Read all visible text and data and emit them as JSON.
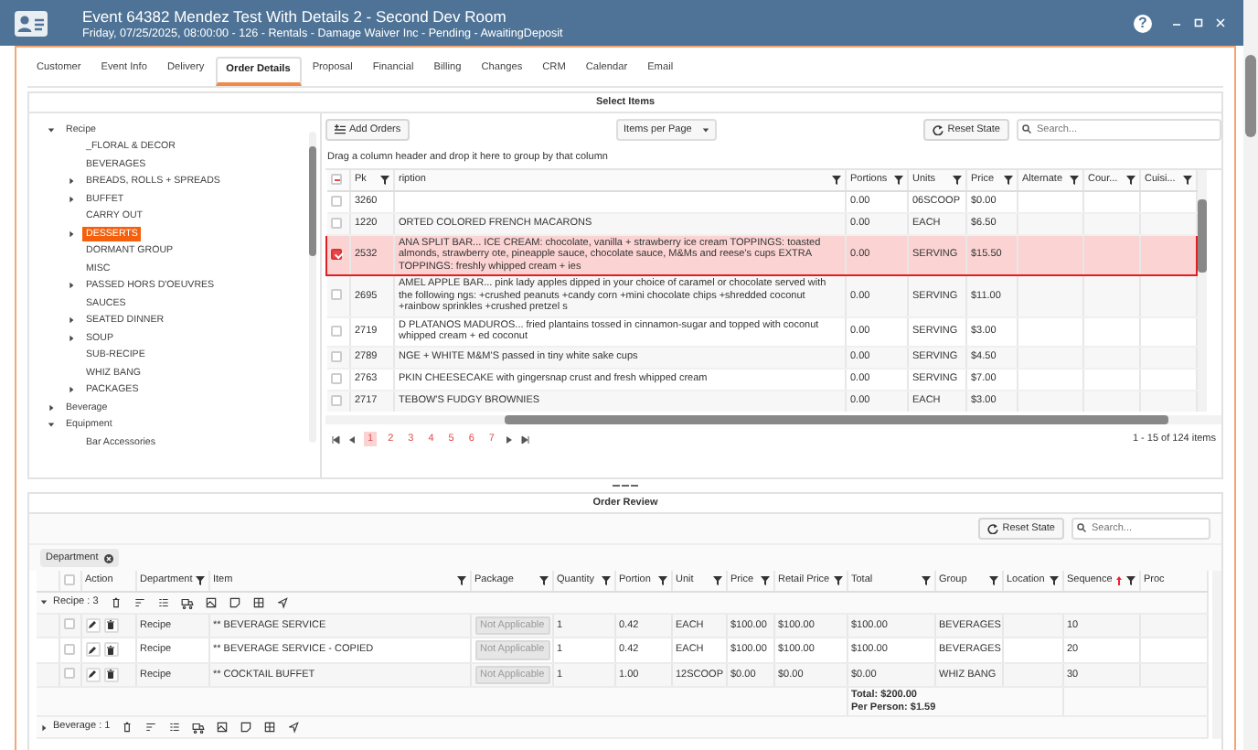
{
  "window": {
    "title": "Event 64382 Mendez Test With Details 2 - Second Dev Room",
    "subtitle": "Friday, 07/25/2025, 08:00:00 - 126 - Rentals - Damage Waiver Inc - Pending - AwaitingDeposit",
    "help": "?"
  },
  "tabs": [
    {
      "label": "Customer",
      "selected": false
    },
    {
      "label": "Event Info",
      "selected": false
    },
    {
      "label": "Delivery",
      "selected": false
    },
    {
      "label": "Order Details",
      "selected": true
    },
    {
      "label": "Proposal",
      "selected": false
    },
    {
      "label": "Financial",
      "selected": false
    },
    {
      "label": "Billing",
      "selected": false
    },
    {
      "label": "Changes",
      "selected": false
    },
    {
      "label": "CRM",
      "selected": false
    },
    {
      "label": "Calendar",
      "selected": false
    },
    {
      "label": "Email",
      "selected": false
    }
  ],
  "select_items": {
    "title": "Select Items",
    "add_button": "Add Orders",
    "page_size": "Items per Page",
    "reset_button": "Reset State",
    "search": {
      "placeholder": "Search..."
    },
    "group_hint": "Drag a column header and drop it here to group by that column",
    "tree": [
      {
        "label": "Recipe",
        "expanded": true,
        "selected": false,
        "children": [
          {
            "label": "_FLORAL & DECOR",
            "selected": false
          },
          {
            "label": "BEVERAGES",
            "selected": false
          },
          {
            "label": "BREADS, ROLLS + SPREADS",
            "expanded": false,
            "selected": false
          },
          {
            "label": "BUFFET",
            "expanded": false,
            "selected": false
          },
          {
            "label": "CARRY OUT",
            "selected": false
          },
          {
            "label": "DESSERTS",
            "expanded": false,
            "selected": true
          },
          {
            "label": "DORMANT GROUP",
            "selected": false
          },
          {
            "label": "MISC",
            "selected": false
          },
          {
            "label": "PASSED HORS D'OEUVRES",
            "expanded": false,
            "selected": false
          },
          {
            "label": "SAUCES",
            "selected": false
          },
          {
            "label": "SEATED DINNER",
            "expanded": false,
            "selected": false
          },
          {
            "label": "SOUP",
            "expanded": false,
            "selected": false
          },
          {
            "label": "SUB-RECIPE",
            "selected": false
          },
          {
            "label": "WHIZ BANG",
            "selected": false
          },
          {
            "label": "PACKAGES",
            "expanded": false,
            "selected": false
          }
        ]
      },
      {
        "label": "Beverage",
        "expanded": false,
        "selected": false
      },
      {
        "label": "Equipment",
        "expanded": true,
        "selected": false,
        "children": [
          {
            "label": "Bar Accessories",
            "selected": false
          }
        ]
      }
    ],
    "select_all_partial": true,
    "columns": [
      "Pk",
      "ription",
      "Portions",
      "Units",
      "Price",
      "Alternate",
      "Cour...",
      "Cuisi..."
    ],
    "rows": [
      {
        "pk": "3260",
        "portions": "0.00",
        "units": "06SCOOP",
        "price": "$0.00",
        "checked": false
      },
      {
        "pk": "1220",
        "description": "ORTED COLORED FRENCH MACARONS",
        "portions": "0.00",
        "units": "EACH",
        "price": "$6.50",
        "checked": false
      },
      {
        "pk": "2532",
        "description": "ANA SPLIT BAR... ICE CREAM: chocolate, vanilla + strawberry ice cream TOPPINGS: toasted almonds, strawberry ote, pineapple sauce, chocolate sauce, M&Ms and reese's cups EXTRA TOPPINGS: freshly whipped cream + ies",
        "portions": "0.00",
        "units": "SERVING",
        "price": "$15.50",
        "checked": true
      },
      {
        "pk": "2695",
        "description": "AMEL APPLE BAR... pink lady apples dipped in your choice of caramel or chocolate served with the following ngs: +crushed peanuts +candy corn +mini chocolate chips +shredded coconut +rainbow sprinkles +crushed pretzel s",
        "portions": "0.00",
        "units": "SERVING",
        "price": "$11.00",
        "checked": false
      },
      {
        "pk": "2719",
        "description": "D PLATANOS MADUROS... fried plantains tossed in cinnamon-sugar and topped with coconut whipped cream + ed coconut",
        "portions": "0.00",
        "units": "SERVING",
        "price": "$3.00",
        "checked": false
      },
      {
        "pk": "2789",
        "description": "NGE + WHITE M&M'S passed in tiny white sake cups",
        "portions": "0.00",
        "units": "SERVING",
        "price": "$4.50",
        "checked": false
      },
      {
        "pk": "2763",
        "description": "PKIN CHEESECAKE with gingersnap crust and fresh whipped cream",
        "portions": "0.00",
        "units": "SERVING",
        "price": "$7.00",
        "checked": false
      },
      {
        "pk": "2717",
        "description": "TEBOW'S FUDGY BROWNIES",
        "portions": "0.00",
        "units": "EACH",
        "price": "$3.00",
        "checked": false
      }
    ],
    "pages": [
      {
        "label": "1",
        "selected": true
      },
      {
        "label": "2",
        "selected": false
      },
      {
        "label": "3",
        "selected": false
      },
      {
        "label": "4",
        "selected": false
      },
      {
        "label": "5",
        "selected": false
      },
      {
        "label": "6",
        "selected": false
      },
      {
        "label": "7",
        "selected": false
      }
    ],
    "summary": "1 - 15 of 124 items"
  },
  "order_review": {
    "title": "Order Review",
    "reset_button": "Reset State",
    "search": {
      "placeholder": "Search..."
    },
    "group_chip": "Department",
    "select_all": false,
    "columns": [
      {
        "label": "Action",
        "filter": false
      },
      {
        "label": "Department",
        "filter": true
      },
      {
        "label": "Item",
        "filter": true
      },
      {
        "label": "Package",
        "filter": true
      },
      {
        "label": "Quantity",
        "filter": true
      },
      {
        "label": "Portion",
        "filter": true
      },
      {
        "label": "Unit",
        "filter": true
      },
      {
        "label": "Price",
        "filter": true
      },
      {
        "label": "Retail Price",
        "filter": true
      },
      {
        "label": "Total",
        "filter": true
      },
      {
        "label": "Group",
        "filter": true
      },
      {
        "label": "Location",
        "filter": true
      },
      {
        "label": "Sequence",
        "filter": true,
        "sorted_ascending": true
      },
      {
        "label": "Proc",
        "filter": false
      }
    ],
    "groups": [
      {
        "label": "Recipe : 3",
        "expanded": true,
        "rows": [
          {
            "department": "Recipe",
            "item": "** BEVERAGE SERVICE",
            "package": "Not Applicable",
            "quantity": "1",
            "portion": "0.42",
            "unit": "EACH",
            "price": "$100.00",
            "retail_price": "$100.00",
            "total": "$100.00",
            "group": "BEVERAGES",
            "sequence": "10",
            "checked": false
          },
          {
            "department": "Recipe",
            "item": "** BEVERAGE SERVICE - COPIED",
            "package": "Not Applicable",
            "quantity": "1",
            "portion": "0.42",
            "unit": "EACH",
            "price": "$100.00",
            "retail_price": "$100.00",
            "total": "$100.00",
            "group": "BEVERAGES",
            "sequence": "20",
            "checked": false
          },
          {
            "department": "Recipe",
            "item": "** COCKTAIL BUFFET",
            "package": "Not Applicable",
            "quantity": "1",
            "portion": "1.00",
            "unit": "12SCOOP",
            "price": "$0.00",
            "retail_price": "$0.00",
            "total": "$0.00",
            "group": "WHIZ BANG",
            "sequence": "30",
            "checked": false
          }
        ],
        "total": "Total: $200.00",
        "per_person": "Per Person: $1.59"
      },
      {
        "label": "Beverage : 1",
        "expanded": false
      }
    ]
  }
}
